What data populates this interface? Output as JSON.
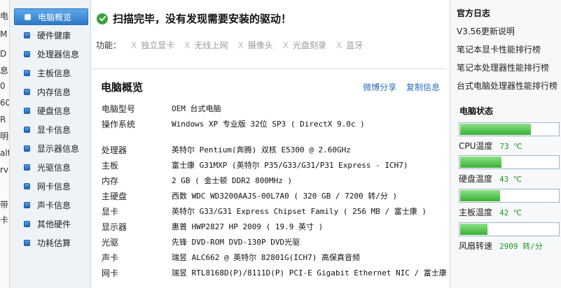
{
  "behind_window": {
    "chars": [
      "电",
      "M",
      "D",
      "息",
      "0",
      "60",
      "R",
      "明细",
      "alt",
      "rv",
      "带",
      "卡"
    ]
  },
  "sidebar": {
    "items": [
      {
        "label": "电脑概览",
        "active": true
      },
      {
        "label": "硬件健康"
      },
      {
        "label": "处理器信息"
      },
      {
        "label": "主板信息"
      },
      {
        "label": "内存信息"
      },
      {
        "label": "硬盘信息"
      },
      {
        "label": "显卡信息"
      },
      {
        "label": "显示器信息"
      },
      {
        "label": "光驱信息"
      },
      {
        "label": "网卡信息"
      },
      {
        "label": "声卡信息"
      },
      {
        "label": "其他硬件"
      },
      {
        "label": "功耗估算"
      }
    ]
  },
  "main": {
    "scan_status": "扫描完毕，没有发现需要安装的驱动！",
    "functions_label": "功能：",
    "functions": [
      "独立显卡",
      "无线上网",
      "摄像头",
      "光盘刻录",
      "蓝牙"
    ],
    "overview_title": "电脑概览",
    "share_link": "微博分享",
    "copy_link": "复制信息",
    "info": [
      {
        "key": "电脑型号",
        "value": "OEM 台式电脑"
      },
      {
        "key": "操作系统",
        "value": "Windows XP 专业版 32位 SP3 ( DirectX 9.0c )"
      },
      {
        "key": "处理器",
        "value": "英特尔 Pentium(奔腾) 双核 E5300 @ 2.60GHz"
      },
      {
        "key": "主板",
        "value": "富士康 G31MXP (英特尔 P35/G33/G31/P31 Express - ICH7)"
      },
      {
        "key": "内存",
        "value": "2 GB ( 金士顿 DDR2 800MHz )"
      },
      {
        "key": "主硬盘",
        "value": "西数 WDC WD3200AAJS-00L7A0 ( 320 GB / 7200 转/分 )"
      },
      {
        "key": "显卡",
        "value": "英特尔 G33/G31 Express Chipset Family ( 256 MB / 富士康 )"
      },
      {
        "key": "显示器",
        "value": "惠普 HWP2827 HP 2009 ( 19.9 英寸 )"
      },
      {
        "key": "光驱",
        "value": "先锋 DVD-ROM DVD-130P DVD光驱"
      },
      {
        "key": "声卡",
        "value": "瑞昱 ALC662 @ 英特尔 82801G(ICH7) 高保真音频"
      },
      {
        "key": "网卡",
        "value": "瑞昱 RTL8168D(P)/8111D(P) PCI-E Gigabit Ethernet NIC / 富士康"
      }
    ]
  },
  "right": {
    "log_title": "官方日志",
    "links": [
      "V3.56更新说明",
      "笔记本显卡性能排行榜",
      "笔记本处理器性能排行榜",
      "台式电脑处理器性能排行榜"
    ],
    "status_title": "电脑状态",
    "gauges": [
      {
        "label": "CPU温度",
        "value": "73 ℃",
        "fraction": 0.72
      },
      {
        "label": "硬盘温度",
        "value": "43 ℃",
        "fraction": 0.42
      },
      {
        "label": "主板温度",
        "value": "42 ℃",
        "fraction": 0.41
      },
      {
        "label": "风扇转速",
        "value": "2909 转/分",
        "fraction": 0.28
      }
    ]
  },
  "colors": {
    "accent": "#2d79c9",
    "ok_green": "#3aa23a",
    "value_green": "#1a9a1a",
    "link_blue": "#2a6fb8"
  }
}
